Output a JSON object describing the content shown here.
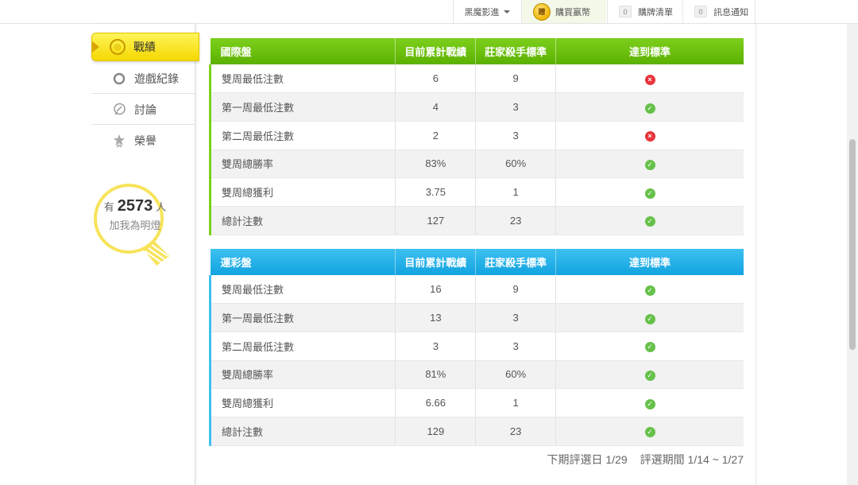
{
  "topbar": {
    "menu_label": "黑魔影進",
    "buy_coin_text": "贈",
    "buy_label": "購買嬴幣",
    "cart_count": "0",
    "cart_label": "購牌清單",
    "msg_count": "0",
    "msg_label": "訊息通知"
  },
  "sidebar": {
    "active": {
      "label": "戰績",
      "icon": "target-icon"
    },
    "items": [
      {
        "label": "遊戲紀錄",
        "icon": "circle-icon"
      },
      {
        "label": "討論",
        "icon": "chat-icon"
      },
      {
        "label": "榮譽",
        "icon": "medal-icon"
      }
    ],
    "bulb": {
      "prefix": "有",
      "count": "2573",
      "suffix": "人",
      "line2": "加我為明燈"
    }
  },
  "tables": {
    "international": {
      "title": "國際盤",
      "headers": [
        "目前累計戰績",
        "莊家殺手標準",
        "達到標準"
      ],
      "rows": [
        {
          "label": "雙周最低注數",
          "current": "6",
          "standard": "9",
          "met": false
        },
        {
          "label": "第一周最低注數",
          "current": "4",
          "standard": "3",
          "met": true
        },
        {
          "label": "第二周最低注數",
          "current": "2",
          "standard": "3",
          "met": false
        },
        {
          "label": "雙周總勝率",
          "current": "83%",
          "standard": "60%",
          "met": true
        },
        {
          "label": "雙周總獲利",
          "current": "3.75",
          "standard": "1",
          "met": true
        },
        {
          "label": "總計注數",
          "current": "127",
          "standard": "23",
          "met": true
        }
      ]
    },
    "lottery": {
      "title": "運彩盤",
      "headers": [
        "目前累計戰績",
        "莊家殺手標準",
        "達到標準"
      ],
      "rows": [
        {
          "label": "雙周最低注數",
          "current": "16",
          "standard": "9",
          "met": true
        },
        {
          "label": "第一周最低注數",
          "current": "13",
          "standard": "3",
          "met": true
        },
        {
          "label": "第二周最低注數",
          "current": "3",
          "standard": "3",
          "met": true
        },
        {
          "label": "雙周總勝率",
          "current": "81%",
          "standard": "60%",
          "met": true
        },
        {
          "label": "雙周總獲利",
          "current": "6.66",
          "standard": "1",
          "met": true
        },
        {
          "label": "總計注數",
          "current": "129",
          "standard": "23",
          "met": true
        }
      ]
    }
  },
  "footer": {
    "next_review": "下期評選日 1/29",
    "review_period": "評選期間 1/14 ~ 1/27"
  },
  "colors": {
    "green": "#6cc20e",
    "blue": "#22aee8",
    "ok": "#66c14a",
    "fail": "#e8343a",
    "active_menu": "#f5d800"
  }
}
